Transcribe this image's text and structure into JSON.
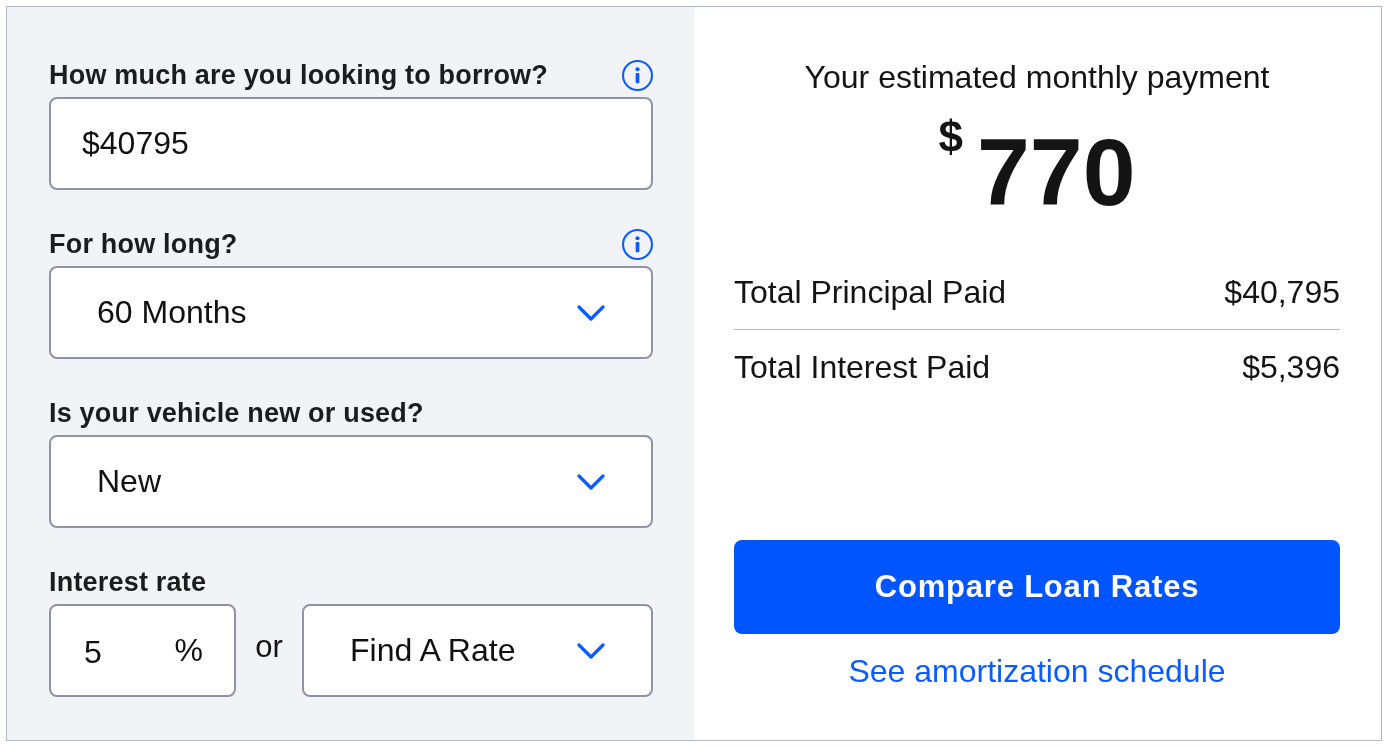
{
  "form": {
    "fields": [
      {
        "kind": "input",
        "label": "How much are you looking to borrow?",
        "info": true,
        "value": "$40795"
      },
      {
        "kind": "select",
        "label": "For how long?",
        "info": true,
        "value": "60 Months"
      },
      {
        "kind": "select",
        "label": "Is your vehicle new or used?",
        "info": false,
        "value": "New"
      },
      {
        "kind": "rate",
        "label": "Interest rate",
        "info": false,
        "rate_input": {
          "value": "5",
          "unit": "%"
        },
        "separator": "or",
        "rate_select": {
          "value": "Find A Rate"
        }
      }
    ]
  },
  "summary": {
    "title": "Your estimated monthly payment",
    "currency": "$",
    "amount": "770",
    "rows": [
      {
        "label": "Total Principal Paid",
        "value": "$40,795"
      },
      {
        "label": "Total Interest Paid",
        "value": "$5,396"
      }
    ],
    "button": "Compare Loan Rates",
    "link": "See amortization schedule"
  }
}
